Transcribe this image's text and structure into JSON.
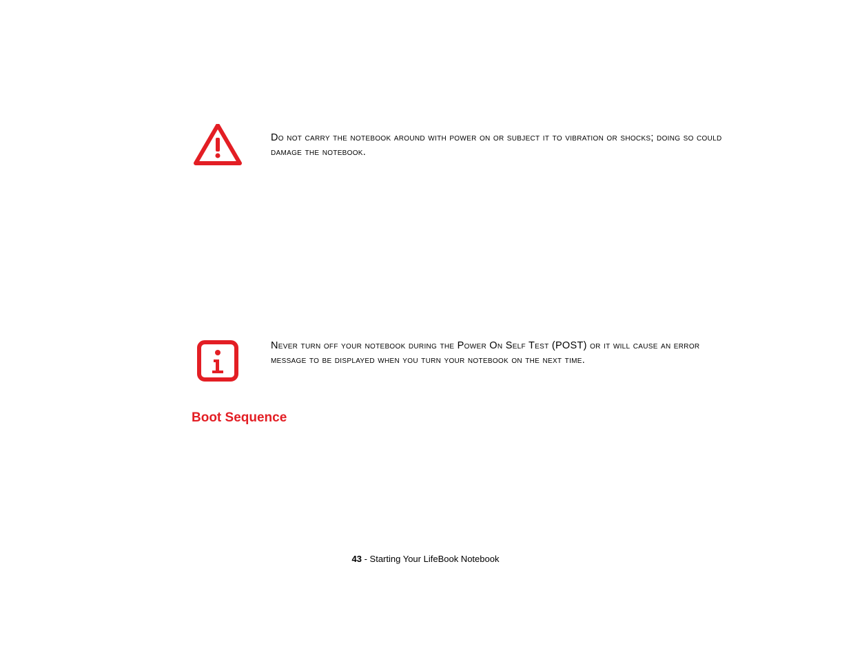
{
  "callouts": {
    "warning": {
      "text": "Do not carry the notebook around with power on or subject it to vibration or shocks; doing so could damage the notebook."
    },
    "info": {
      "text": "Never turn off your notebook during the Power On Self Test (POST) or it will cause an error message to be displayed when you turn your notebook on the next time."
    }
  },
  "section": {
    "heading": "Boot Sequence"
  },
  "footer": {
    "pageNumber": "43",
    "separator": " - ",
    "chapterTitle": "Starting Your LifeBook Notebook"
  }
}
